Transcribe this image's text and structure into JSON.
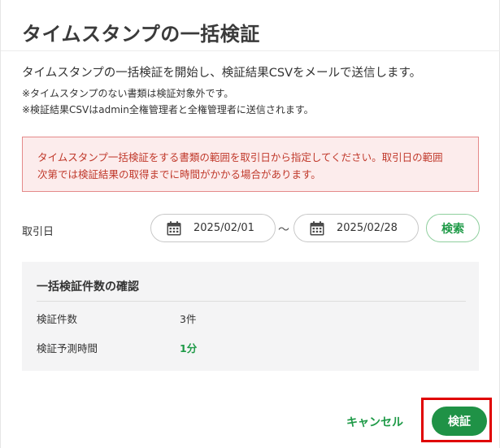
{
  "dialog": {
    "title": "タイムスタンプの一括検証",
    "description": "タイムスタンプの一括検証を開始し、検証結果CSVをメールで送信します。",
    "notes": [
      "※タイムスタンプのない書類は検証対象外です。",
      "※検証結果CSVはadmin全権管理者と全権管理者に送信されます。"
    ],
    "alert": {
      "line1": "タイムスタンプ一括検証をする書類の範囲を取引日から指定してください。取引日の範囲",
      "line2": "次第では検証結果の取得までに時間がかかる場合があります。"
    }
  },
  "date_range": {
    "label": "取引日",
    "start": "2025/02/01",
    "separator": "〜",
    "end": "2025/02/28",
    "search_label": "検索",
    "icon": "calendar-icon"
  },
  "confirmation": {
    "title": "一括検証件数の確認",
    "rows": [
      {
        "label": "検証件数",
        "value": "3件"
      },
      {
        "label": "検証予測時間",
        "value": "1分"
      }
    ]
  },
  "footer": {
    "cancel_label": "キャンセル",
    "verify_label": "検証"
  },
  "colors": {
    "accent_green": "#1f9246",
    "alert_border": "#e58a8a",
    "alert_bg": "#fcecec",
    "alert_text": "#c0392b",
    "highlight": "#e00000"
  }
}
